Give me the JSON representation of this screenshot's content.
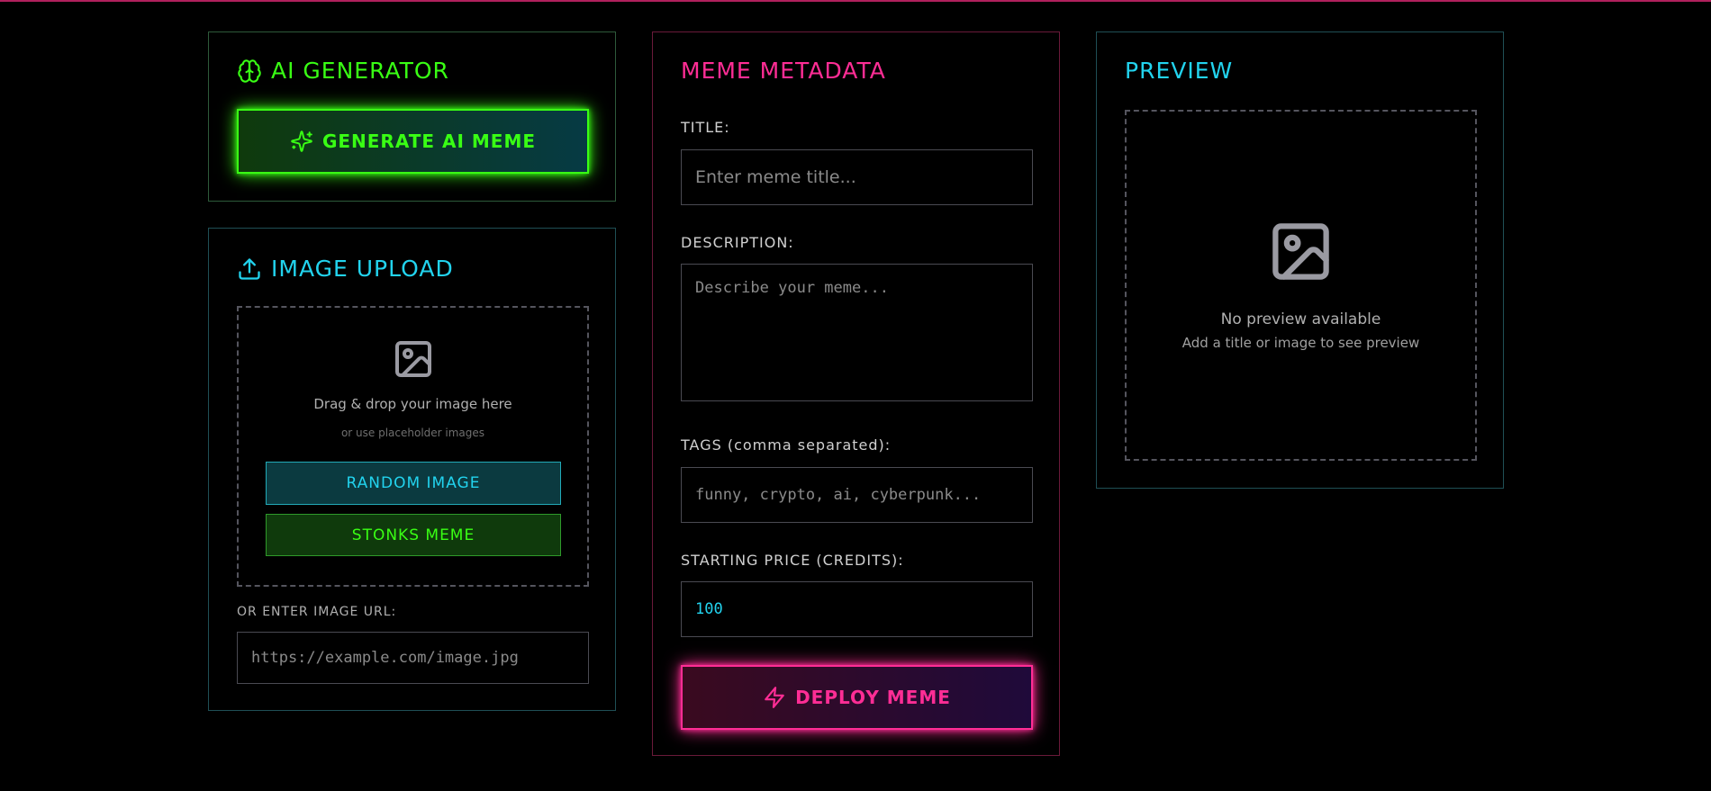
{
  "ai_generator": {
    "title": "AI GENERATOR",
    "generate_label": "GENERATE AI MEME"
  },
  "image_upload": {
    "title": "IMAGE UPLOAD",
    "drop_text": "Drag & drop your image here",
    "drop_subtext": "or use placeholder images",
    "random_label": "RANDOM IMAGE",
    "stonks_label": "STONKS MEME",
    "url_label": "OR ENTER IMAGE URL:",
    "url_placeholder": "https://example.com/image.jpg"
  },
  "metadata": {
    "title": "MEME METADATA",
    "title_label": "TITLE:",
    "title_placeholder": "Enter meme title...",
    "description_label": "DESCRIPTION:",
    "description_placeholder": "Describe your meme...",
    "tags_label": "TAGS (comma separated):",
    "tags_placeholder": "funny, crypto, ai, cyberpunk...",
    "price_label": "STARTING PRICE (CREDITS):",
    "price_value": "100",
    "deploy_label": "DEPLOY MEME"
  },
  "preview": {
    "title": "PREVIEW",
    "empty_text": "No preview available",
    "empty_subtext": "Add a title or image to see preview"
  },
  "colors": {
    "green": "#39ff14",
    "cyan": "#22d3ee",
    "pink": "#ff2d95",
    "panel_border_green": "#2d5a3a",
    "panel_border_teal": "#1f4f55",
    "panel_border_pink": "#6a1a3a"
  },
  "icons": {
    "ai": "brain-icon",
    "sparkles": "sparkles-icon",
    "upload": "upload-icon",
    "image": "image-icon",
    "zap": "zap-icon"
  }
}
